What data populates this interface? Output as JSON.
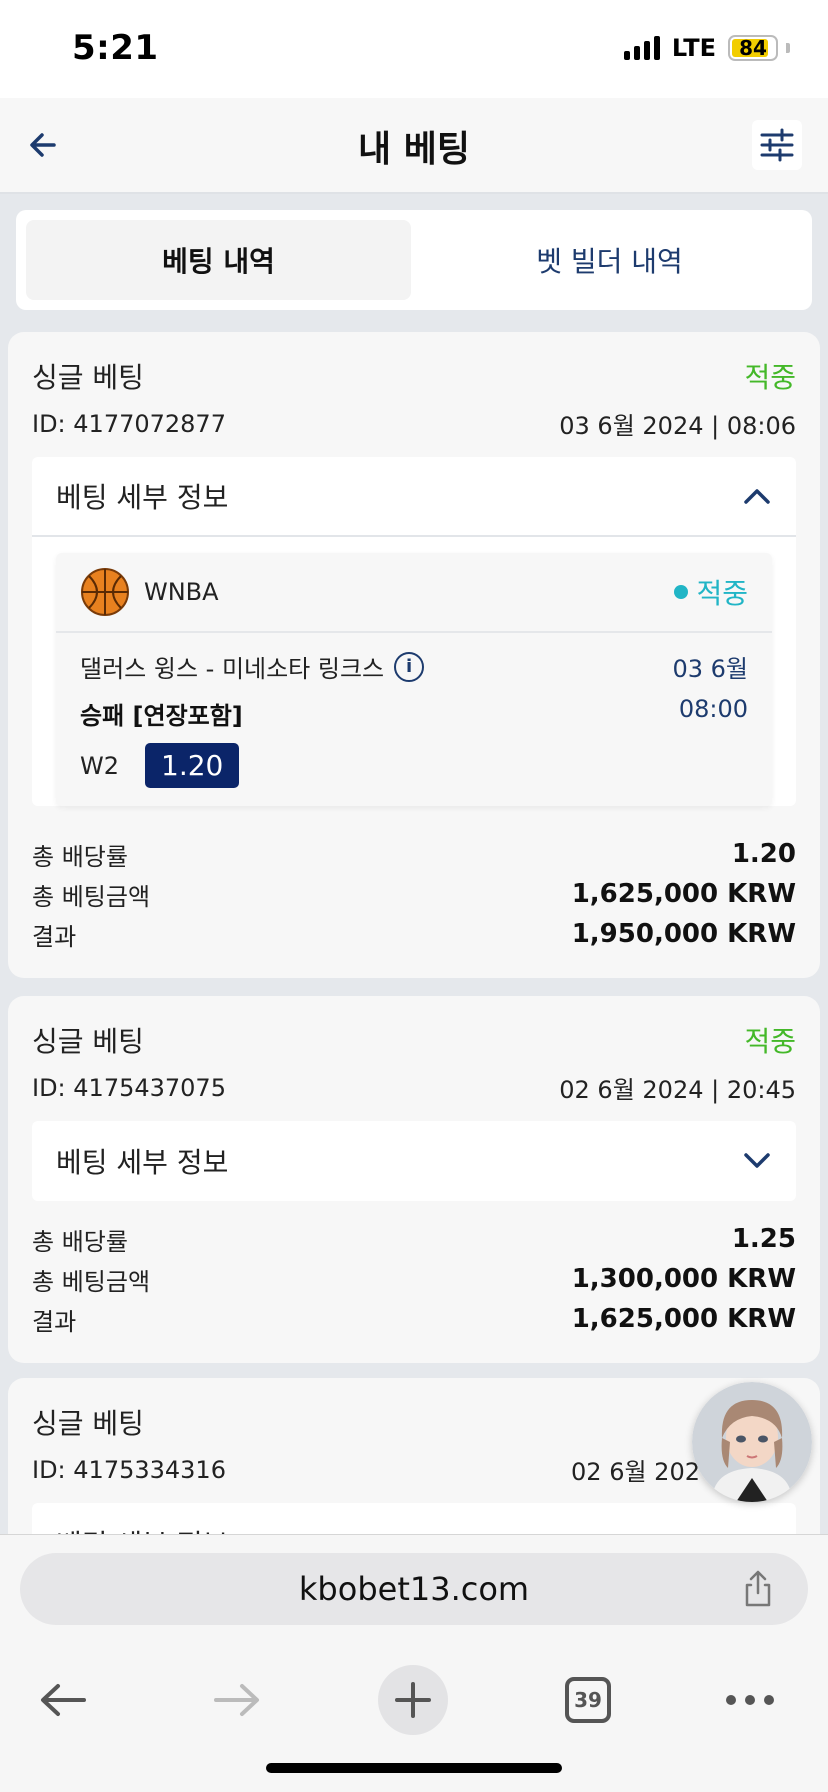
{
  "status_bar": {
    "time": "5:21",
    "network": "LTE",
    "battery": "84"
  },
  "header": {
    "title": "내 베팅",
    "back_icon": "back-arrow-icon",
    "filter_icon": "sliders-icon"
  },
  "tabs": [
    {
      "label": "베팅 내역",
      "active": true
    },
    {
      "label": "벳 빌더 내역",
      "active": false
    }
  ],
  "bets": [
    {
      "type": "싱글 베팅",
      "status": "적중",
      "id": "ID: 4177072877",
      "date": "03 6월 2024 | 08:06",
      "details_label": "베팅 세부 정보",
      "expanded": true,
      "selection": {
        "league": "WNBA",
        "status": "적중",
        "match": "댈러스 윙스 - 미네소타 링크스",
        "market": "승패 [연장포함]",
        "date": "03 6월",
        "time": "08:00",
        "pick": "W2",
        "odds": "1.20"
      },
      "total_odds_label": "총 배당률",
      "total_odds": "1.20",
      "stake_label": "총 베팅금액",
      "stake": "1,625,000 KRW",
      "result_label": "결과",
      "result": "1,950,000 KRW"
    },
    {
      "type": "싱글 베팅",
      "status": "적중",
      "id": "ID: 4175437075",
      "date": "02 6월 2024 | 20:45",
      "details_label": "베팅 세부 정보",
      "expanded": false,
      "total_odds_label": "총 배당률",
      "total_odds": "1.25",
      "stake_label": "총 베팅금액",
      "stake": "1,300,000 KRW",
      "result_label": "결과",
      "result": "1,625,000 KRW"
    },
    {
      "type": "싱글 베팅",
      "id": "ID: 4175334316",
      "date": "02 6월 202",
      "details_label": "베팅 세부 정보",
      "expanded": false
    }
  ],
  "browser": {
    "url": "kbobet13.com",
    "tab_count": "39"
  },
  "colors": {
    "win_green": "#44b829",
    "teal": "#21b5c6",
    "navy": "#0b2569",
    "link_blue": "#1d3b6e"
  }
}
